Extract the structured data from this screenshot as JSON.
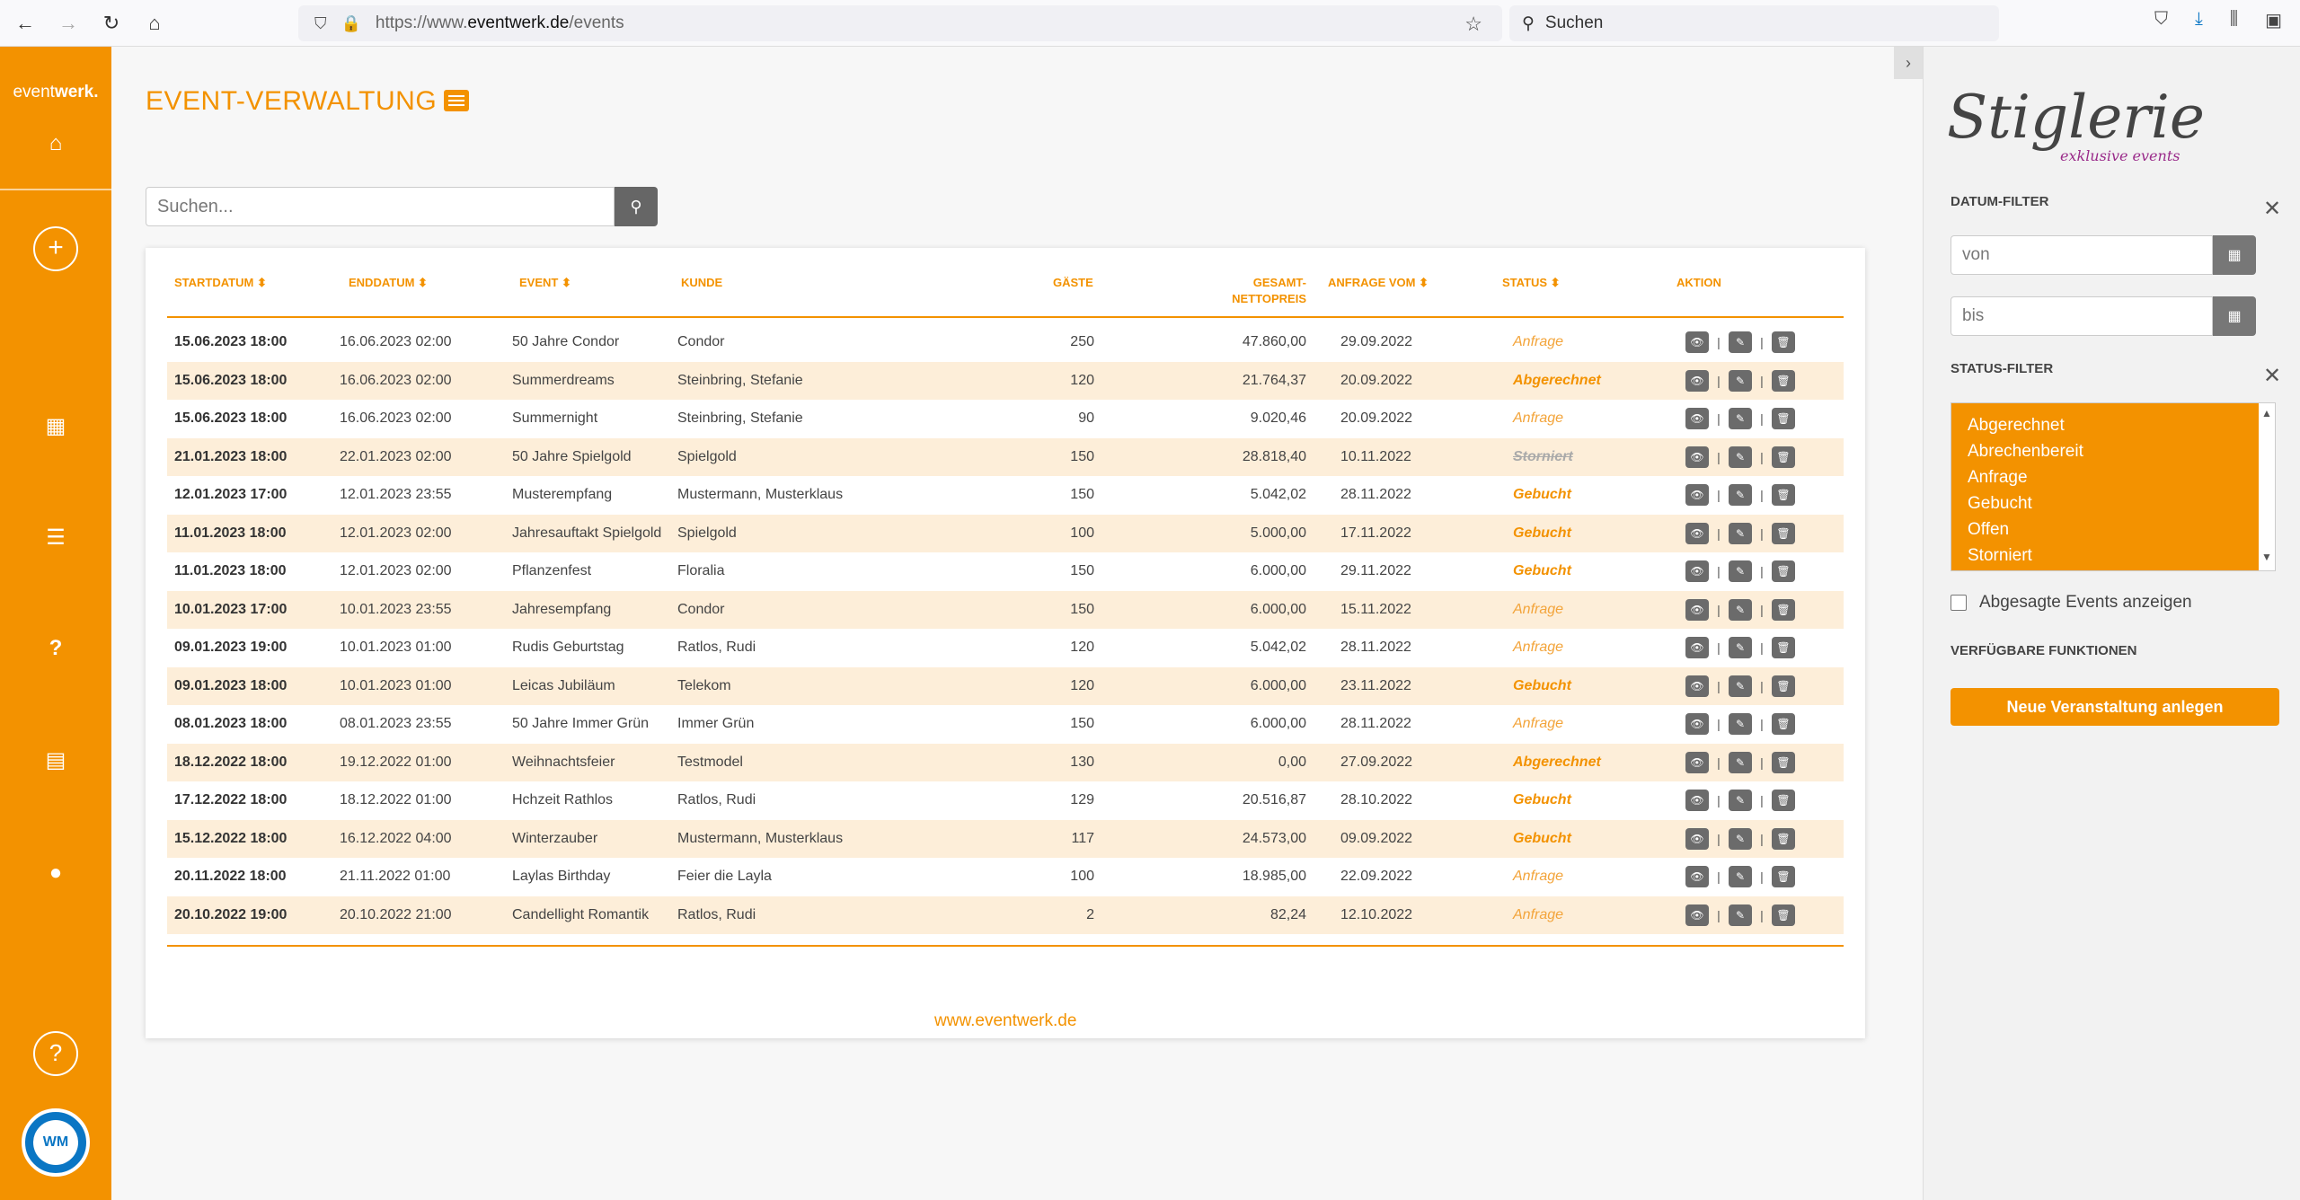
{
  "browser": {
    "url_prefix": "https://www.",
    "url_domain": "eventwerk.de",
    "url_path": "/events",
    "search_placeholder": "Suchen"
  },
  "sidebar": {
    "logo_light": "event",
    "logo_bold": "werk.",
    "avatar_initials": "WM"
  },
  "main": {
    "title": "EVENT-VERWALTUNG",
    "search_placeholder": "Suchen...",
    "footer_link": "www.eventwerk.de"
  },
  "table": {
    "headers": {
      "start": "STARTDATUM ⬍",
      "end": "ENDDATUM ⬍",
      "event": "EVENT ⬍",
      "customer": "KUNDE",
      "guests": "GÄSTE",
      "price_line1": "GESAMT-",
      "price_line2": "NETTOPREIS",
      "requested": "ANFRAGE VOM ⬍",
      "status": "STATUS ⬍",
      "action": "AKTION"
    },
    "rows": [
      {
        "start": "15.06.2023 18:00",
        "end": "16.06.2023 02:00",
        "event": "50 Jahre Condor",
        "customer": "Condor",
        "guests": "250",
        "price": "47.860,00",
        "requested": "29.09.2022",
        "status": "Anfrage",
        "style": "light"
      },
      {
        "start": "15.06.2023 18:00",
        "end": "16.06.2023 02:00",
        "event": "Summerdreams",
        "customer": "Steinbring, Stefanie",
        "guests": "120",
        "price": "21.764,37",
        "requested": "20.09.2022",
        "status": "Abgerechnet",
        "style": "bold"
      },
      {
        "start": "15.06.2023 18:00",
        "end": "16.06.2023 02:00",
        "event": "Summernight",
        "customer": "Steinbring, Stefanie",
        "guests": "90",
        "price": "9.020,46",
        "requested": "20.09.2022",
        "status": "Anfrage",
        "style": "light"
      },
      {
        "start": "21.01.2023 18:00",
        "end": "22.01.2023 02:00",
        "event": "50 Jahre Spielgold",
        "customer": "Spielgold",
        "guests": "150",
        "price": "28.818,40",
        "requested": "10.11.2022",
        "status": "Storniert",
        "style": "struck"
      },
      {
        "start": "12.01.2023 17:00",
        "end": "12.01.2023 23:55",
        "event": "Musterempfang",
        "customer": "Mustermann, Musterklaus",
        "guests": "150",
        "price": "5.042,02",
        "requested": "28.11.2022",
        "status": "Gebucht",
        "style": "bold"
      },
      {
        "start": "11.01.2023 18:00",
        "end": "12.01.2023 02:00",
        "event": "Jahresauftakt Spielgold",
        "customer": "Spielgold",
        "guests": "100",
        "price": "5.000,00",
        "requested": "17.11.2022",
        "status": "Gebucht",
        "style": "bold"
      },
      {
        "start": "11.01.2023 18:00",
        "end": "12.01.2023 02:00",
        "event": "Pflanzenfest",
        "customer": "Floralia",
        "guests": "150",
        "price": "6.000,00",
        "requested": "29.11.2022",
        "status": "Gebucht",
        "style": "bold"
      },
      {
        "start": "10.01.2023 17:00",
        "end": "10.01.2023 23:55",
        "event": "Jahresempfang",
        "customer": "Condor",
        "guests": "150",
        "price": "6.000,00",
        "requested": "15.11.2022",
        "status": "Anfrage",
        "style": "light"
      },
      {
        "start": "09.01.2023 19:00",
        "end": "10.01.2023 01:00",
        "event": "Rudis Geburtstag",
        "customer": "Ratlos, Rudi",
        "guests": "120",
        "price": "5.042,02",
        "requested": "28.11.2022",
        "status": "Anfrage",
        "style": "light"
      },
      {
        "start": "09.01.2023 18:00",
        "end": "10.01.2023 01:00",
        "event": "Leicas Jubiläum",
        "customer": "Telekom",
        "guests": "120",
        "price": "6.000,00",
        "requested": "23.11.2022",
        "status": "Gebucht",
        "style": "bold"
      },
      {
        "start": "08.01.2023 18:00",
        "end": "08.01.2023 23:55",
        "event": "50 Jahre Immer Grün",
        "customer": "Immer Grün",
        "guests": "150",
        "price": "6.000,00",
        "requested": "28.11.2022",
        "status": "Anfrage",
        "style": "light"
      },
      {
        "start": "18.12.2022 18:00",
        "end": "19.12.2022 01:00",
        "event": "Weihnachtsfeier",
        "customer": "Testmodel",
        "guests": "130",
        "price": "0,00",
        "requested": "27.09.2022",
        "status": "Abgerechnet",
        "style": "bold"
      },
      {
        "start": "17.12.2022 18:00",
        "end": "18.12.2022 01:00",
        "event": "Hchzeit Rathlos",
        "customer": "Ratlos, Rudi",
        "guests": "129",
        "price": "20.516,87",
        "requested": "28.10.2022",
        "status": "Gebucht",
        "style": "bold"
      },
      {
        "start": "15.12.2022 18:00",
        "end": "16.12.2022 04:00",
        "event": "Winterzauber",
        "customer": "Mustermann, Musterklaus",
        "guests": "117",
        "price": "24.573,00",
        "requested": "09.09.2022",
        "status": "Gebucht",
        "style": "bold"
      },
      {
        "start": "20.11.2022 18:00",
        "end": "21.11.2022 01:00",
        "event": "Laylas Birthday",
        "customer": "Feier die Layla",
        "guests": "100",
        "price": "18.985,00",
        "requested": "22.09.2022",
        "status": "Anfrage",
        "style": "light"
      },
      {
        "start": "20.10.2022 19:00",
        "end": "20.10.2022 21:00",
        "event": "Candellight Romantik",
        "customer": "Ratlos, Rudi",
        "guests": "2",
        "price": "82,24",
        "requested": "12.10.2022",
        "status": "Anfrage",
        "style": "light"
      }
    ]
  },
  "panel": {
    "brand_name": "Stiglerie",
    "brand_sub": "exklusive events",
    "date_filter_title": "DATUM-FILTER",
    "from_placeholder": "von",
    "to_placeholder": "bis",
    "status_filter_title": "STATUS-FILTER",
    "status_options": [
      "Abgerechnet",
      "Abrechenbereit",
      "Anfrage",
      "Gebucht",
      "Offen",
      "Storniert"
    ],
    "show_cancelled_label": "Abgesagte Events anzeigen",
    "functions_title": "VERFÜGBARE FUNKTIONEN",
    "create_button": "Neue Veranstaltung anlegen"
  },
  "colors": {
    "accent": "#f39200",
    "row_alt": "#fdeed9",
    "brand_sub": "#9a2b8a"
  }
}
